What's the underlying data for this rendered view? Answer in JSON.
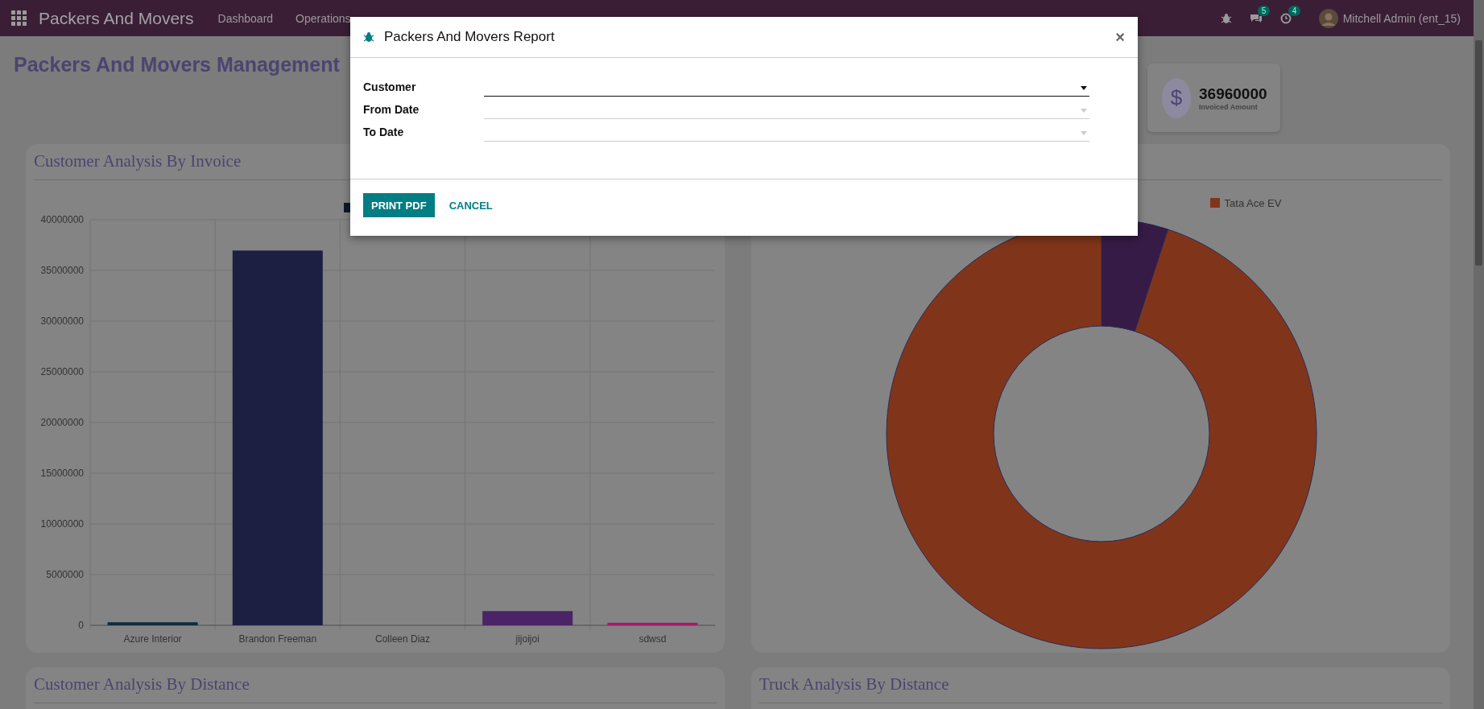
{
  "navbar": {
    "app_name": "Packers And Movers",
    "menu": [
      "Dashboard",
      "Operations"
    ],
    "messages_badge": "5",
    "activities_badge": "4",
    "user": "Mitchell Admin (ent_15)"
  },
  "page_title": "Packers And Movers Management",
  "invoiced": {
    "symbol": "$",
    "value": "36960000",
    "label": "Invoiced Amount"
  },
  "cards": [
    {
      "title": "Customer Analysis By Invoice",
      "chart_data": {
        "type": "bar",
        "grid": true,
        "categories": [
          "Azure Interior",
          "Brandon Freeman",
          "Colleen Diaz",
          "jijoijoi",
          "sdwsd"
        ],
        "values": [
          300000,
          36960000,
          0,
          1400000,
          250000
        ],
        "ylim": [
          0,
          40000000
        ],
        "yticks": [
          0,
          5000000,
          10000000,
          15000000,
          20000000,
          25000000,
          30000000,
          35000000,
          40000000
        ]
      }
    },
    {
      "legend": [
        {
          "label": "Tata Ace EV",
          "color": "#80351b"
        }
      ]
    },
    {
      "title": "Customer Analysis By Distance"
    },
    {
      "title": "Truck Analysis By Distance"
    }
  ],
  "dialog": {
    "title": "Packers And Movers Report",
    "close": "×",
    "fields": [
      {
        "label": "Customer",
        "focused": true
      },
      {
        "label": "From Date",
        "focused": false
      },
      {
        "label": "To Date",
        "focused": false
      }
    ],
    "primary_button": "PRINT PDF",
    "secondary_button": "CANCEL"
  }
}
